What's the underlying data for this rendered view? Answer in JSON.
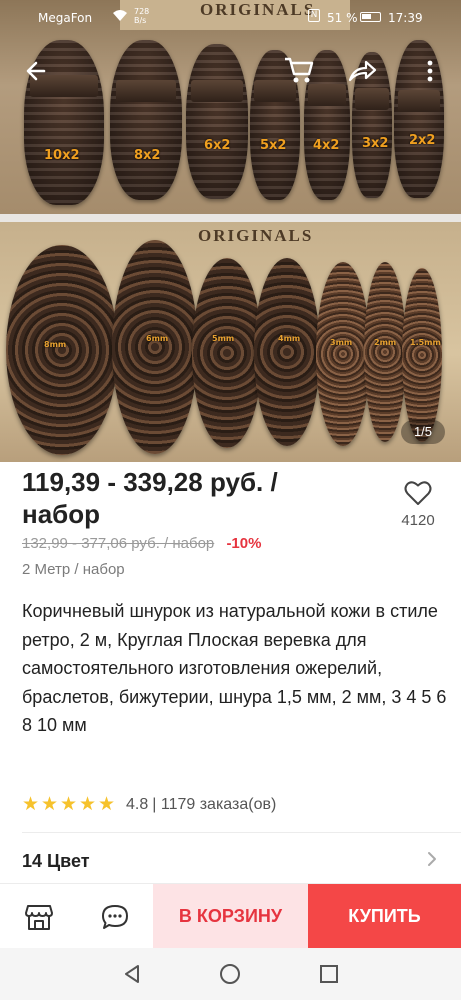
{
  "status_bar": {
    "carrier": "MegaFon",
    "net_speed_value": "728",
    "net_speed_unit": "B/s",
    "battery": "51 %",
    "time": "17:39"
  },
  "product_image": {
    "brand_text_top": "ORIGINALS",
    "brand_text_bottom": "ORIGINALS",
    "flat_labels": [
      "10x2",
      "8x2",
      "6x2",
      "5x2",
      "4x2",
      "3x2",
      "2x2"
    ],
    "round_labels": [
      "8mm",
      "6mm",
      "5mm",
      "4mm",
      "3mm",
      "2mm",
      "1.5mm"
    ],
    "pager": "1/5"
  },
  "product": {
    "price": "119,39 - 339,28 руб. / набор",
    "old_price": "132,99 - 377,06 руб. / набор",
    "discount": "-10%",
    "unit": "2 Метр / набор",
    "title": "Коричневый шнурок из натуральной кожи в стиле ретро, 2 м, Круглая Плоская веревка для самостоятельного изготовления ожерелий, браслетов, бижутерии, шнура 1,5 мм, 2 мм, 3 4 5 6 8 10 мм",
    "rating": "4.8",
    "orders": "| 1179 заказа(ов)",
    "wishlist_count": "4120",
    "color_count": "14 Цвет"
  },
  "actions": {
    "add_to_cart": "В КОРЗИНУ",
    "buy": "КУПИТЬ"
  },
  "colors": {
    "discount_red": "#e6343f",
    "buy_red": "#f44747",
    "cart_pink": "#fde3e5",
    "star_yellow": "#f6c22c"
  },
  "icons": [
    "back-arrow-icon",
    "cart-icon",
    "share-icon",
    "more-vertical-icon",
    "heart-icon",
    "store-icon",
    "chat-icon",
    "chevron-right-icon",
    "nav-back-icon",
    "nav-home-icon",
    "nav-recent-icon"
  ]
}
